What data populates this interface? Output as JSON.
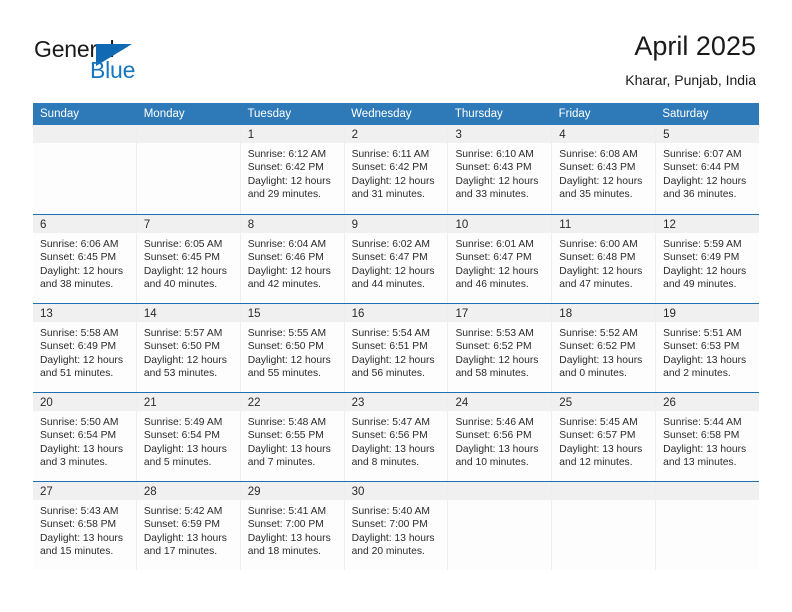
{
  "logo": {
    "primary_text": "General",
    "secondary_text": "Blue",
    "triangle_color": "#1168b3",
    "blue_text_color": "#1676c0"
  },
  "header": {
    "title": "April 2025",
    "subtitle": "Kharar, Punjab, India"
  },
  "theme": {
    "header_row_bg": "#2e7ab8",
    "week_divider": "#1f6fb2",
    "daynum_band_bg": "#f0f0f0",
    "cell_bg": "#fdfdfd"
  },
  "weekdays": [
    "Sunday",
    "Monday",
    "Tuesday",
    "Wednesday",
    "Thursday",
    "Friday",
    "Saturday"
  ],
  "labels": {
    "sunrise_prefix": "Sunrise:",
    "sunset_prefix": "Sunset:",
    "daylight_prefix": "Daylight:"
  },
  "weeks": [
    [
      {
        "day": "",
        "sunrise": "",
        "sunset": "",
        "daylight_line1": "",
        "daylight_line2": ""
      },
      {
        "day": "",
        "sunrise": "",
        "sunset": "",
        "daylight_line1": "",
        "daylight_line2": ""
      },
      {
        "day": "1",
        "sunrise": "Sunrise: 6:12 AM",
        "sunset": "Sunset: 6:42 PM",
        "daylight_line1": "Daylight: 12 hours",
        "daylight_line2": "and 29 minutes."
      },
      {
        "day": "2",
        "sunrise": "Sunrise: 6:11 AM",
        "sunset": "Sunset: 6:42 PM",
        "daylight_line1": "Daylight: 12 hours",
        "daylight_line2": "and 31 minutes."
      },
      {
        "day": "3",
        "sunrise": "Sunrise: 6:10 AM",
        "sunset": "Sunset: 6:43 PM",
        "daylight_line1": "Daylight: 12 hours",
        "daylight_line2": "and 33 minutes."
      },
      {
        "day": "4",
        "sunrise": "Sunrise: 6:08 AM",
        "sunset": "Sunset: 6:43 PM",
        "daylight_line1": "Daylight: 12 hours",
        "daylight_line2": "and 35 minutes."
      },
      {
        "day": "5",
        "sunrise": "Sunrise: 6:07 AM",
        "sunset": "Sunset: 6:44 PM",
        "daylight_line1": "Daylight: 12 hours",
        "daylight_line2": "and 36 minutes."
      }
    ],
    [
      {
        "day": "6",
        "sunrise": "Sunrise: 6:06 AM",
        "sunset": "Sunset: 6:45 PM",
        "daylight_line1": "Daylight: 12 hours",
        "daylight_line2": "and 38 minutes."
      },
      {
        "day": "7",
        "sunrise": "Sunrise: 6:05 AM",
        "sunset": "Sunset: 6:45 PM",
        "daylight_line1": "Daylight: 12 hours",
        "daylight_line2": "and 40 minutes."
      },
      {
        "day": "8",
        "sunrise": "Sunrise: 6:04 AM",
        "sunset": "Sunset: 6:46 PM",
        "daylight_line1": "Daylight: 12 hours",
        "daylight_line2": "and 42 minutes."
      },
      {
        "day": "9",
        "sunrise": "Sunrise: 6:02 AM",
        "sunset": "Sunset: 6:47 PM",
        "daylight_line1": "Daylight: 12 hours",
        "daylight_line2": "and 44 minutes."
      },
      {
        "day": "10",
        "sunrise": "Sunrise: 6:01 AM",
        "sunset": "Sunset: 6:47 PM",
        "daylight_line1": "Daylight: 12 hours",
        "daylight_line2": "and 46 minutes."
      },
      {
        "day": "11",
        "sunrise": "Sunrise: 6:00 AM",
        "sunset": "Sunset: 6:48 PM",
        "daylight_line1": "Daylight: 12 hours",
        "daylight_line2": "and 47 minutes."
      },
      {
        "day": "12",
        "sunrise": "Sunrise: 5:59 AM",
        "sunset": "Sunset: 6:49 PM",
        "daylight_line1": "Daylight: 12 hours",
        "daylight_line2": "and 49 minutes."
      }
    ],
    [
      {
        "day": "13",
        "sunrise": "Sunrise: 5:58 AM",
        "sunset": "Sunset: 6:49 PM",
        "daylight_line1": "Daylight: 12 hours",
        "daylight_line2": "and 51 minutes."
      },
      {
        "day": "14",
        "sunrise": "Sunrise: 5:57 AM",
        "sunset": "Sunset: 6:50 PM",
        "daylight_line1": "Daylight: 12 hours",
        "daylight_line2": "and 53 minutes."
      },
      {
        "day": "15",
        "sunrise": "Sunrise: 5:55 AM",
        "sunset": "Sunset: 6:50 PM",
        "daylight_line1": "Daylight: 12 hours",
        "daylight_line2": "and 55 minutes."
      },
      {
        "day": "16",
        "sunrise": "Sunrise: 5:54 AM",
        "sunset": "Sunset: 6:51 PM",
        "daylight_line1": "Daylight: 12 hours",
        "daylight_line2": "and 56 minutes."
      },
      {
        "day": "17",
        "sunrise": "Sunrise: 5:53 AM",
        "sunset": "Sunset: 6:52 PM",
        "daylight_line1": "Daylight: 12 hours",
        "daylight_line2": "and 58 minutes."
      },
      {
        "day": "18",
        "sunrise": "Sunrise: 5:52 AM",
        "sunset": "Sunset: 6:52 PM",
        "daylight_line1": "Daylight: 13 hours",
        "daylight_line2": "and 0 minutes."
      },
      {
        "day": "19",
        "sunrise": "Sunrise: 5:51 AM",
        "sunset": "Sunset: 6:53 PM",
        "daylight_line1": "Daylight: 13 hours",
        "daylight_line2": "and 2 minutes."
      }
    ],
    [
      {
        "day": "20",
        "sunrise": "Sunrise: 5:50 AM",
        "sunset": "Sunset: 6:54 PM",
        "daylight_line1": "Daylight: 13 hours",
        "daylight_line2": "and 3 minutes."
      },
      {
        "day": "21",
        "sunrise": "Sunrise: 5:49 AM",
        "sunset": "Sunset: 6:54 PM",
        "daylight_line1": "Daylight: 13 hours",
        "daylight_line2": "and 5 minutes."
      },
      {
        "day": "22",
        "sunrise": "Sunrise: 5:48 AM",
        "sunset": "Sunset: 6:55 PM",
        "daylight_line1": "Daylight: 13 hours",
        "daylight_line2": "and 7 minutes."
      },
      {
        "day": "23",
        "sunrise": "Sunrise: 5:47 AM",
        "sunset": "Sunset: 6:56 PM",
        "daylight_line1": "Daylight: 13 hours",
        "daylight_line2": "and 8 minutes."
      },
      {
        "day": "24",
        "sunrise": "Sunrise: 5:46 AM",
        "sunset": "Sunset: 6:56 PM",
        "daylight_line1": "Daylight: 13 hours",
        "daylight_line2": "and 10 minutes."
      },
      {
        "day": "25",
        "sunrise": "Sunrise: 5:45 AM",
        "sunset": "Sunset: 6:57 PM",
        "daylight_line1": "Daylight: 13 hours",
        "daylight_line2": "and 12 minutes."
      },
      {
        "day": "26",
        "sunrise": "Sunrise: 5:44 AM",
        "sunset": "Sunset: 6:58 PM",
        "daylight_line1": "Daylight: 13 hours",
        "daylight_line2": "and 13 minutes."
      }
    ],
    [
      {
        "day": "27",
        "sunrise": "Sunrise: 5:43 AM",
        "sunset": "Sunset: 6:58 PM",
        "daylight_line1": "Daylight: 13 hours",
        "daylight_line2": "and 15 minutes."
      },
      {
        "day": "28",
        "sunrise": "Sunrise: 5:42 AM",
        "sunset": "Sunset: 6:59 PM",
        "daylight_line1": "Daylight: 13 hours",
        "daylight_line2": "and 17 minutes."
      },
      {
        "day": "29",
        "sunrise": "Sunrise: 5:41 AM",
        "sunset": "Sunset: 7:00 PM",
        "daylight_line1": "Daylight: 13 hours",
        "daylight_line2": "and 18 minutes."
      },
      {
        "day": "30",
        "sunrise": "Sunrise: 5:40 AM",
        "sunset": "Sunset: 7:00 PM",
        "daylight_line1": "Daylight: 13 hours",
        "daylight_line2": "and 20 minutes."
      },
      {
        "day": "",
        "sunrise": "",
        "sunset": "",
        "daylight_line1": "",
        "daylight_line2": ""
      },
      {
        "day": "",
        "sunrise": "",
        "sunset": "",
        "daylight_line1": "",
        "daylight_line2": ""
      },
      {
        "day": "",
        "sunrise": "",
        "sunset": "",
        "daylight_line1": "",
        "daylight_line2": ""
      }
    ]
  ]
}
